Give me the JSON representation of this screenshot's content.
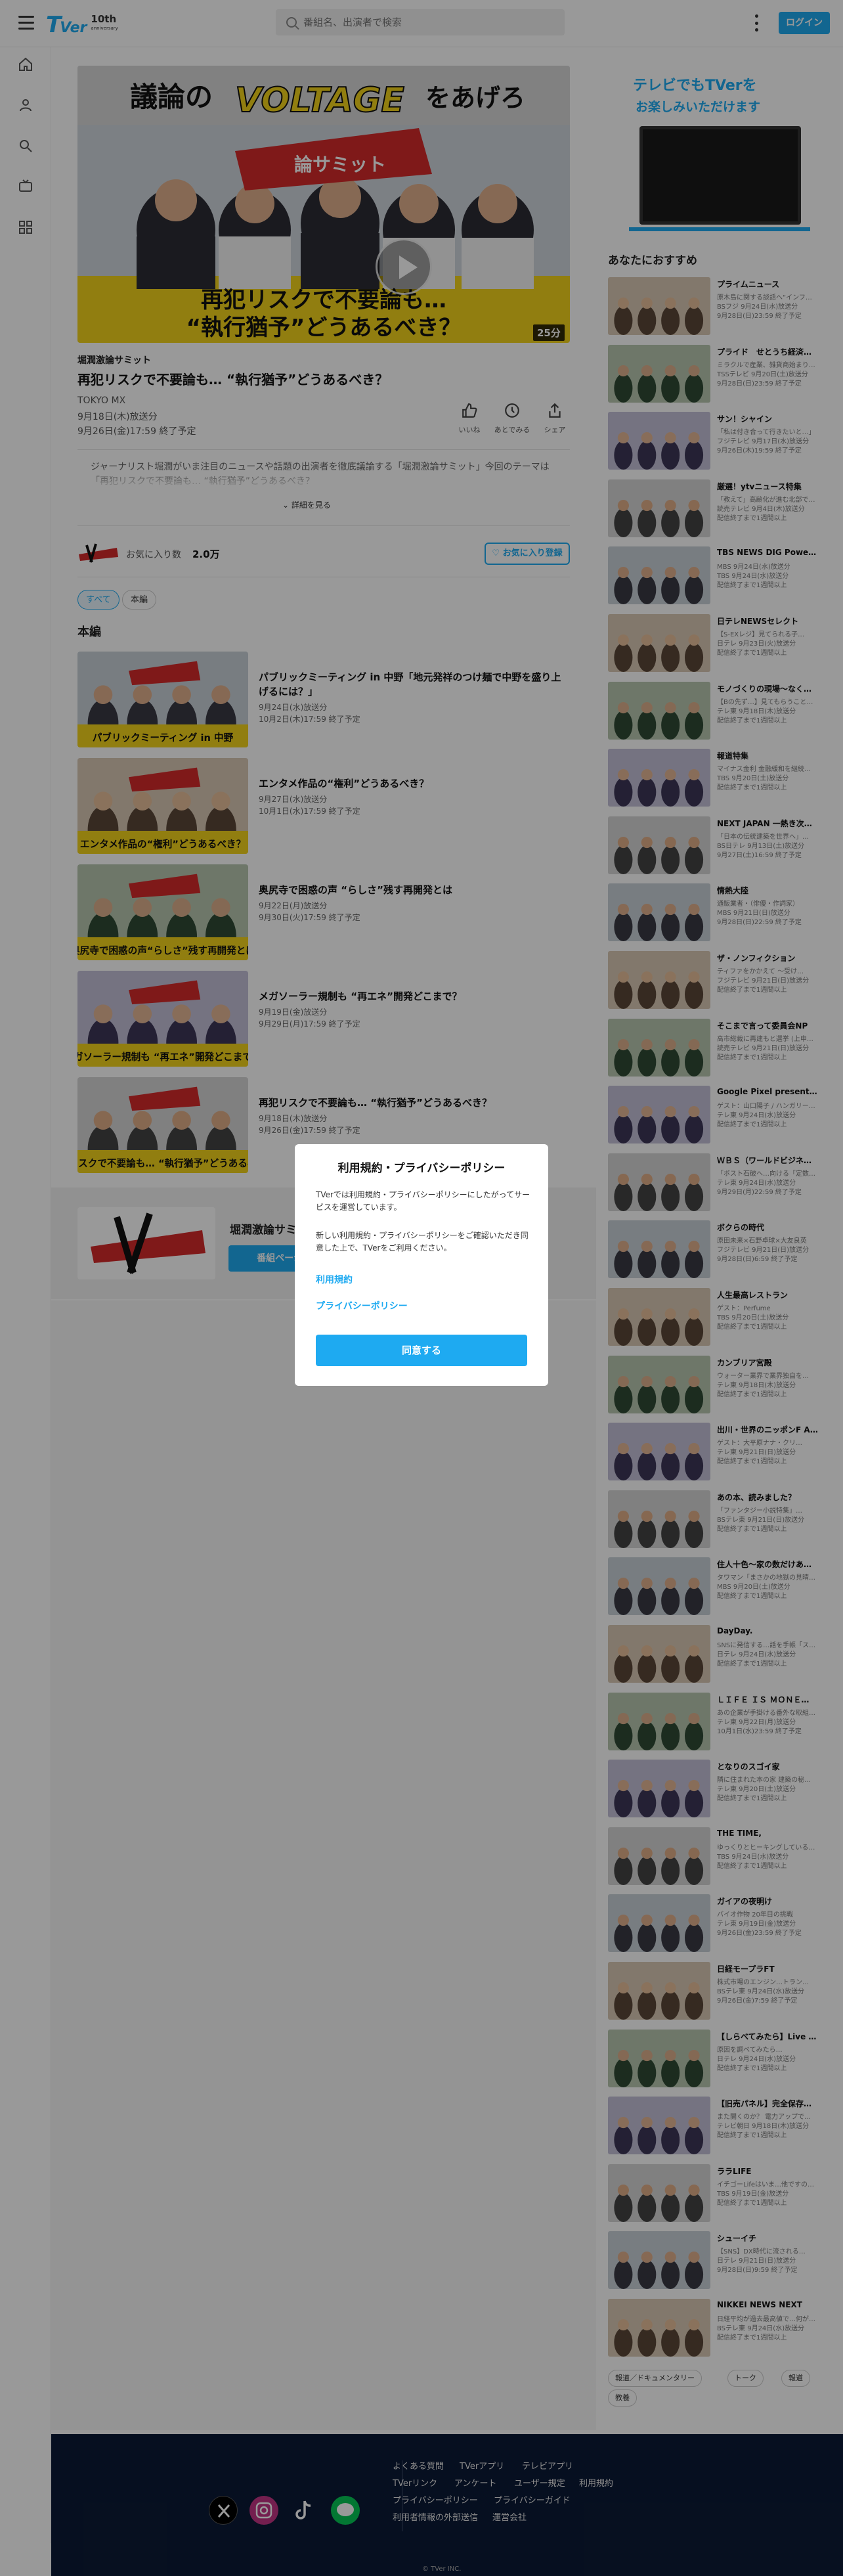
{
  "header": {
    "logo_text_t": "T",
    "logo_text_ver": "Ver",
    "logo_anniv": "10th",
    "logo_anniv_sub": "anniversary",
    "search_placeholder": "番組名、出演者で検索",
    "login_label": "ログイン"
  },
  "colors": {
    "accent": "#1eaaf1",
    "footer_bg": "#0b1a36",
    "overlay": "rgba(0,0,0,0.4)"
  },
  "player": {
    "hero_text_top": "議論の",
    "hero_text_voltage": "VOLTAGE",
    "hero_text_right": "をあげろ",
    "hero_banner": "論サミット",
    "hero_caption_1": "再犯リスクで不要論も…",
    "hero_caption_2": "“執行猶予”どうあるべき？",
    "duration": "25分"
  },
  "episode": {
    "series_name": "堀潤激論サミット",
    "title": "再犯リスクで不要論も… “執行猶予”どうあるべき？",
    "broadcaster": "TOKYO MX",
    "aired": "9月18日(木)放送分",
    "expires": "9月26日(金)17:59 終了予定",
    "description": "ジャーナリスト堀潤がいま注目のニュースや話題の出演者を徹底議論する「堀潤激論サミット」今回のテーマは「再犯リスクで不要論も… “執行猶予”どうあるべき？",
    "more_label": "詳細を見る",
    "actions": [
      {
        "label": "いいね",
        "icon": "thumbs-up-icon"
      },
      {
        "label": "あとでみる",
        "icon": "bookmark-icon"
      },
      {
        "label": "シェア",
        "icon": "share-icon"
      }
    ]
  },
  "favorite": {
    "count_label": "お気に入り数",
    "count": "2.0万",
    "button_label": "♡ お気に入り登録"
  },
  "filters": {
    "all": "すべて",
    "main": "本編"
  },
  "section_title": "本編",
  "episodes": [
    {
      "title": "パブリックミーティング in 中野「地元発祥のつけ麺で中野を盛り上げるには？」",
      "aired": "9月24日(水)放送分",
      "expires": "10月2日(木)17:59 終了予定",
      "thumb_caption": "パブリックミーティング in 中野"
    },
    {
      "title": "エンタメ作品の“権利”どうあるべき？",
      "aired": "9月27日(水)放送分",
      "expires": "10月1日(水)17:59 終了予定",
      "thumb_caption": "エンタメ作品の“権利”どうあるべき？"
    },
    {
      "title": "奥尻寺で困惑の声 “らしさ”残す再開発とは",
      "aired": "9月22日(月)放送分",
      "expires": "9月30日(火)17:59 終了予定",
      "thumb_caption": "奥尻寺で困惑の声“らしさ”残す再開発とは"
    },
    {
      "title": "メガソーラー規制も “再エネ”開発どこまで？",
      "aired": "9月19日(金)放送分",
      "expires": "9月29日(月)17:59 終了予定",
      "thumb_caption": "メガソーラー規制も “再エネ”開発どこまで？"
    },
    {
      "title": "再犯リスクで不要論も… “執行猶予”どうあるべき？",
      "aired": "9月18日(木)放送分",
      "expires": "9月26日(金)17:59 終了予定",
      "thumb_caption": "再犯リスクで不要論も… “執行猶予”どうあるべき？"
    }
  ],
  "series_card": {
    "name": "堀潤激論サミット",
    "button_label": "番組ページへ"
  },
  "sidebar": {
    "banner_line1": "テレビでもTVerを",
    "banner_line2": "お楽しみいただけます",
    "recommend_title": "あなたにおすすめ",
    "recommendations": [
      {
        "title": "プライムニュース",
        "sub1": "原木島に関する談話へ“インフ…",
        "sub2": "BSフジ 9月24日(水)放送分",
        "sub3": "9月28日(日)23:59 終了予定"
      },
      {
        "title": "プライド　せとうち経済の…",
        "sub1": "ミラクルで産業、雑貨商始まり…",
        "sub2": "TSSテレビ 9月20日(土)放送分",
        "sub3": "9月28日(日)23:59 終了予定"
      },
      {
        "title": "サン！シャイン",
        "sub1": "「私は付き合って行きたいと…」",
        "sub2": "フジテレビ 9月17日(水)放送分",
        "sub3": "9月26日(木)19:59 終了予定"
      },
      {
        "title": "厳選！ytvニュース特集",
        "sub1": "「教えて」高齢化が進む北部で…",
        "sub2": "読売テレビ 9月4日(木)放送分",
        "sub3": "配信終了まで1週間以上"
      },
      {
        "title": "TBS NEWS DIG Power...",
        "sub1": "MBS 9月24日(水)放送分",
        "sub2": "TBS 9月24日(水)放送分",
        "sub3": "配信終了まで1週間以上"
      },
      {
        "title": "日テレNEWSセレクト",
        "sub1": "【S-EXレジ】見てられる子…",
        "sub2": "日テレ 9月23日(火)放送分",
        "sub3": "配信終了まで1週間以上"
      },
      {
        "title": "モノづくりの現場〜なくし…",
        "sub1": "【Bの先ず…】見てもらうこと…",
        "sub2": "テレ東 9月18日(木)放送分",
        "sub3": "配信終了まで1週間以上"
      },
      {
        "title": "報道特集",
        "sub1": "マイナス金利 金融緩和を継続…",
        "sub2": "TBS 9月20日(土)放送分",
        "sub3": "配信終了まで1週間以上"
      },
      {
        "title": "NEXT JAPAN 一熱き次…",
        "sub1": "「日本の伝統建築を世界へ」…",
        "sub2": "BS日テレ 9月13日(土)放送分",
        "sub3": "9月27日(土)16:59 終了予定"
      },
      {
        "title": "情熱大陸",
        "sub1": "通販業者・（俳優・作詞家）",
        "sub2": "MBS 9月21日(日)放送分",
        "sub3": "9月28日(日)22:59 終了予定"
      },
      {
        "title": "ザ・ノンフィクション",
        "sub1": "ティファをかかえて 〜受け…",
        "sub2": "フジテレビ 9月21日(日)放送分",
        "sub3": "配信終了まで1週間以上"
      },
      {
        "title": "そこまで言って委員会NP",
        "sub1": "高市総裁に再建もと選挙 (上申…",
        "sub2": "読売テレビ 9月21日(日)放送分",
        "sub3": "配信終了まで1週間以上"
      },
      {
        "title": "Google Pixel presents...",
        "sub1": "ゲスト：山口陽子 / ハンガリー…",
        "sub2": "テレ東 9月24日(水)放送分",
        "sub3": "配信終了まで1週間以上"
      },
      {
        "title": "ＷＢＳ（ワールドビジネス…",
        "sub1": "「ボスト石破ヘ…向ける「定数…",
        "sub2": "テレ東 9月24日(水)放送分",
        "sub3": "9月29日(月)22:59 終了予定"
      },
      {
        "title": "ボクらの時代",
        "sub1": "原田未来×石野卓球×大友良英",
        "sub2": "フジテレビ 9月21日(日)放送分",
        "sub3": "9月28日(日)6:59 終了予定"
      },
      {
        "title": "人生最高レストラン",
        "sub1": "ゲスト：Perfume",
        "sub2": "TBS 9月20日(土)放送分",
        "sub3": "配信終了まで1週間以上"
      },
      {
        "title": "カンブリア宮殿",
        "sub1": "ウォーター業界で業界独自を…",
        "sub2": "テレ東 9月18日(木)放送分",
        "sub3": "配信終了まで1週間以上"
      },
      {
        "title": "出川・世界のニッポンF A...",
        "sub1": "ゲスト：大平原ナナ・クリ…",
        "sub2": "テレ東 9月21日(日)放送分",
        "sub3": "配信終了まで1週間以上"
      },
      {
        "title": "あの本、読みました？",
        "sub1": "「ファンタジー小説特集」…",
        "sub2": "BSテレ東 9月21日(日)放送分",
        "sub3": "配信終了まで1週間以上"
      },
      {
        "title": "住人十色〜家の数だけある…",
        "sub1": "タワマン「まさかの地獄の見晴…",
        "sub2": "MBS 9月20日(土)放送分",
        "sub3": "配信終了まで1週間以上"
      },
      {
        "title": "DayDay.",
        "sub1": "SNSに発信する…話を手帳「ス…",
        "sub2": "日テレ 9月24日(水)放送分",
        "sub3": "配信終了まで1週間以上"
      },
      {
        "title": "ＬＩＦＥ ＩＳ ＭＯＮＥ…",
        "sub1": "あの企業が手掛ける番外な取組…",
        "sub2": "テレ東 9月22日(月)放送分",
        "sub3": "10月1日(水)23:59 終了予定"
      },
      {
        "title": "となりのスゴイ家",
        "sub1": "隣に住まれた本の家 建築の秘…",
        "sub2": "テレ東 9月20日(土)放送分",
        "sub3": "配信終了まで1週間以上"
      },
      {
        "title": "THE TIME,",
        "sub1": "ゆっくりとヒーキングしている…",
        "sub2": "TBS 9月24日(水)放送分",
        "sub3": "配信終了まで1週間以上"
      },
      {
        "title": "ガイアの夜明け",
        "sub1": "バイオ作物 20年目の挑戦",
        "sub2": "テレ東 9月19日(金)放送分",
        "sub3": "9月26日(金)23:59 終了予定"
      },
      {
        "title": "日経モープラFT",
        "sub1": "株式市場のエンジン…トラン…",
        "sub2": "BSテレ東 9月24日(水)放送分",
        "sub3": "9月26日(金)7:59 終了予定"
      },
      {
        "title": "【しらべてみたら】Live …",
        "sub1": "原因を調べてみたら…",
        "sub2": "日テレ 9月24日(水)放送分",
        "sub3": "配信終了まで1週間以上"
      },
      {
        "title": "【旧売パネル】完全保存…毛…",
        "sub1": "また開くのか？ 電力アップで…",
        "sub2": "テレビ朝日 9月18日(木)放送分",
        "sub3": "配信終了まで1週間以上"
      },
      {
        "title": "ララLIFE",
        "sub1": "イチゴーLifeはいま…他ですの…",
        "sub2": "TBS 9月19日(金)放送分",
        "sub3": "配信終了まで1週間以上"
      },
      {
        "title": "シューイチ",
        "sub1": "【SNS】DX時代に流される…",
        "sub2": "日テレ 9月21日(日)放送分",
        "sub3": "9月28日(日)9:59 終了予定"
      },
      {
        "title": "NIKKEI NEWS NEXT",
        "sub1": "日経平均が過去最高値で…何が…",
        "sub2": "BSテレ東 9月24日(水)放送分",
        "sub3": "配信終了まで1週間以上"
      }
    ],
    "tags": [
      "報道／ドキュメンタリー",
      "トーク",
      "報道",
      "教養"
    ]
  },
  "footer": {
    "links": [
      "よくある質問",
      "TVerアプリ",
      "テレビアプリ",
      "TVerリンク",
      "アンケート",
      "ユーザー規定",
      "利用規約",
      "プライバシーポリシー",
      "プライバシーガイド",
      "利用者情報の外部送信",
      "運営会社"
    ],
    "copyright": "© TVer INC."
  },
  "modal": {
    "title": "利用規約・プライバシーポリシー",
    "text1": "TVerでは利用規約・プライバシーポリシーにしたがってサービスを運営しています。",
    "text2": "新しい利用規約・プライバシーポリシーをご確認いただき同意した上で、TVerをご利用ください。",
    "link_terms": "利用規約",
    "link_privacy": "プライバシーポリシー",
    "agree_label": "同意する"
  }
}
